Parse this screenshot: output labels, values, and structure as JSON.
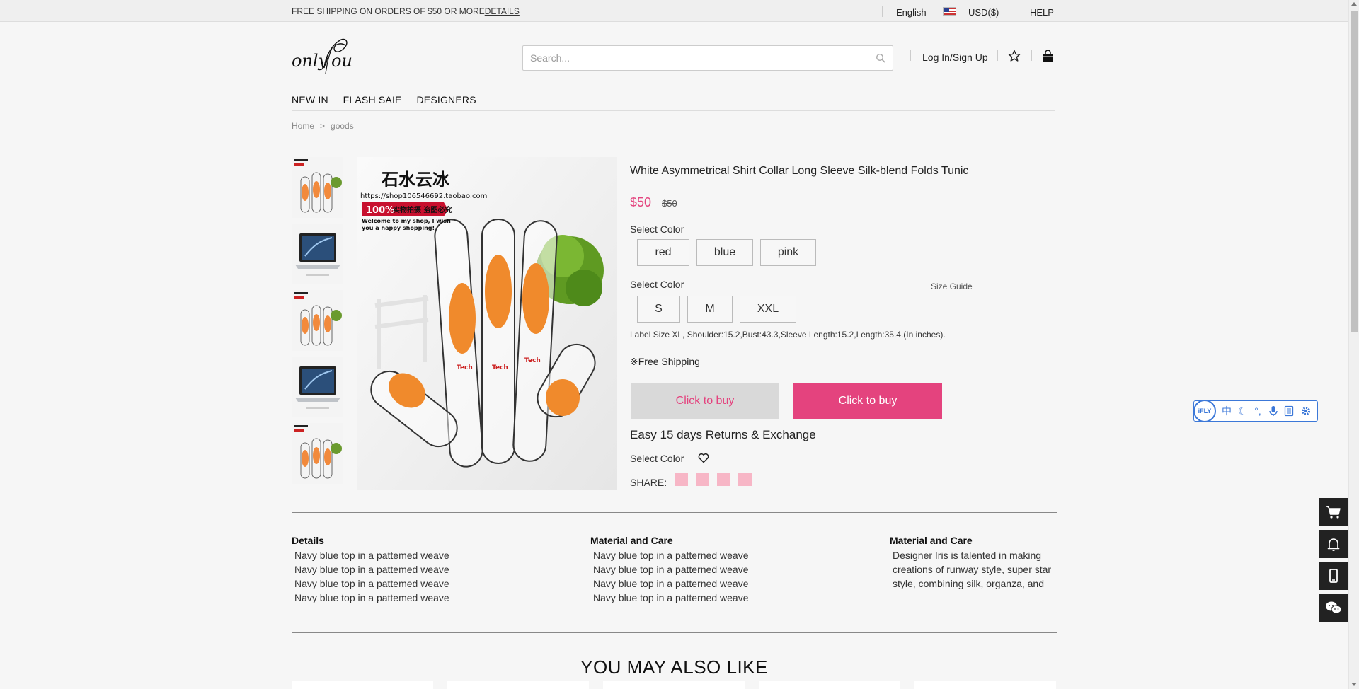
{
  "topbar": {
    "shipping_prefix": "FREE SHIPPING ON ORDERS OF $50 OR MORE",
    "shipping_link": "DETAILS",
    "language": "English",
    "currency": "USD($)",
    "help": "HELP"
  },
  "header": {
    "logo_text": "onlyYou",
    "search_placeholder": "Search...",
    "login": "Log In/Sign Up"
  },
  "nav": [
    "NEW IN",
    "FLASH SAIE",
    "DESIGNERS"
  ],
  "breadcrumb": {
    "home": "Home",
    "sep": ">",
    "current": "goods"
  },
  "product": {
    "title": "White Asymmetrical Shirt Collar Long Sleeve Silk-blend Folds Tunic",
    "price": "$50",
    "old_price": "$50",
    "color_label": "Select Color",
    "colors": [
      "red",
      "blue",
      "pink"
    ],
    "size_label": "Select Color",
    "size_guide": "Size Guide",
    "sizes": [
      "S",
      "M",
      "XXL"
    ],
    "size_note": "Label Size XL, Shoulder:15.2,Bust:43.3,Sleeve Length:15.2,Length:35.4.(In inches).",
    "free_shipping": "※Free Shipping",
    "buy_1": "Click to buy",
    "buy_2": "Click to buy",
    "returns": "Easy 15 days Returns & Exchange",
    "wishlist_label": "Select Color",
    "share_label": "SHARE:"
  },
  "image_text": {
    "shop_name": "石水云冰",
    "shop_url": "https://shop106546692.taobao.com",
    "badge_pct": "100%",
    "badge_text": "实物拍摄 盗图必究",
    "welcome": "Welcome to my shop, I wish you a happy shopping!",
    "tube_label": "Tech"
  },
  "details": [
    {
      "heading": "Details",
      "lines": [
        "Navy blue top in a pattemed weave",
        "Navy blue top in a pattemed weave",
        "Navy blue top in a pattemed weave",
        "Navy blue top in a pattemed weave"
      ]
    },
    {
      "heading": "Material and Care",
      "lines": [
        "Navy blue top in a patterned weave",
        "Navy blue top in a patterned weave",
        "Navy blue top in a patterned weave",
        "Navy blue top in a patterned weave"
      ]
    },
    {
      "heading": "Material and Care",
      "lines": [
        "Designer Iris is talented in making",
        "creations of runway style, super star",
        "style, combining silk, organza, and"
      ]
    }
  ],
  "also_like": "YOU MAY ALSO LIKE",
  "ifly": {
    "logo": "iFLY",
    "icons": [
      "中",
      "☾",
      "°,",
      "🎙",
      "☰",
      "⚙"
    ]
  },
  "colors": {
    "accent": "#e4437e",
    "share": "#f7b6c6",
    "ifly": "#3c78d8"
  }
}
